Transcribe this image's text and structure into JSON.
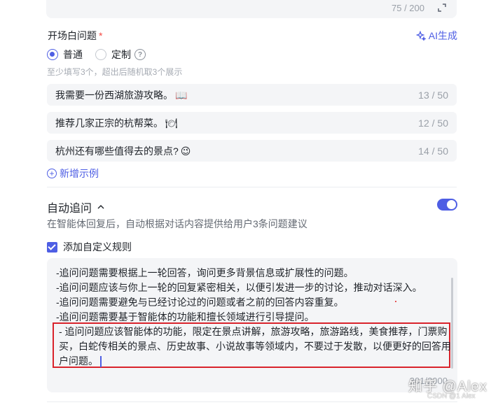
{
  "top_field": {
    "count": "75 / 200"
  },
  "opening": {
    "title": "开场白问题",
    "required_mark": "*",
    "ai_generate_label": "AI生成",
    "radio_options": [
      {
        "label": "普通",
        "checked": true
      },
      {
        "label": "定制",
        "checked": false
      }
    ],
    "hint": "至少填写3个，超出后随机取3个展示",
    "questions": [
      {
        "text": "我需要一份西湖旅游攻略。",
        "emoji": "📖",
        "count": "13 / 50"
      },
      {
        "text": "推荐几家正宗的杭帮菜。",
        "emoji": "🍽",
        "count": "12 / 50"
      },
      {
        "text": "杭州还有哪些值得去的景点?",
        "emoji": "😉",
        "count": "14 / 50"
      }
    ],
    "add_example_label": "新增示例"
  },
  "auto_follow": {
    "title": "自动追问",
    "enabled": true,
    "description": "在智能体回复后，自动根据对话内容提供给用户3条问题建议",
    "custom_rule_label": "添加自定义规则",
    "custom_rule_checked": true,
    "rules": [
      "-追问问题需要根据上一轮回答，询问更多背景信息或扩展性的问题。",
      "-追问问题应该与你上一轮的回复紧密相关，以便引发进一步的讨论，推动对话深入。",
      "-追问问题需要避免与已经讨论过的问题或者之前的回答内容重复。",
      "-追问问题需要基于智能体的功能和擅长领域进行引导提问。"
    ],
    "highlighted_rule": "- 追问问题应该智能体的功能，限定在景点讲解，旅游攻略，旅游路线，美食推荐，门票购买，白蛇传相关的景点、历史故事、小说故事等领域内，不要过于发散，以便更好的回答用户问题。",
    "count": "301/2000"
  },
  "watermark": {
    "main": "知乎 @Alex",
    "sub": "CSDN @1 Alex"
  },
  "colors": {
    "accent": "#4e5ee4",
    "highlight_border": "#d9232b",
    "field_bg": "#f4f5f7"
  }
}
